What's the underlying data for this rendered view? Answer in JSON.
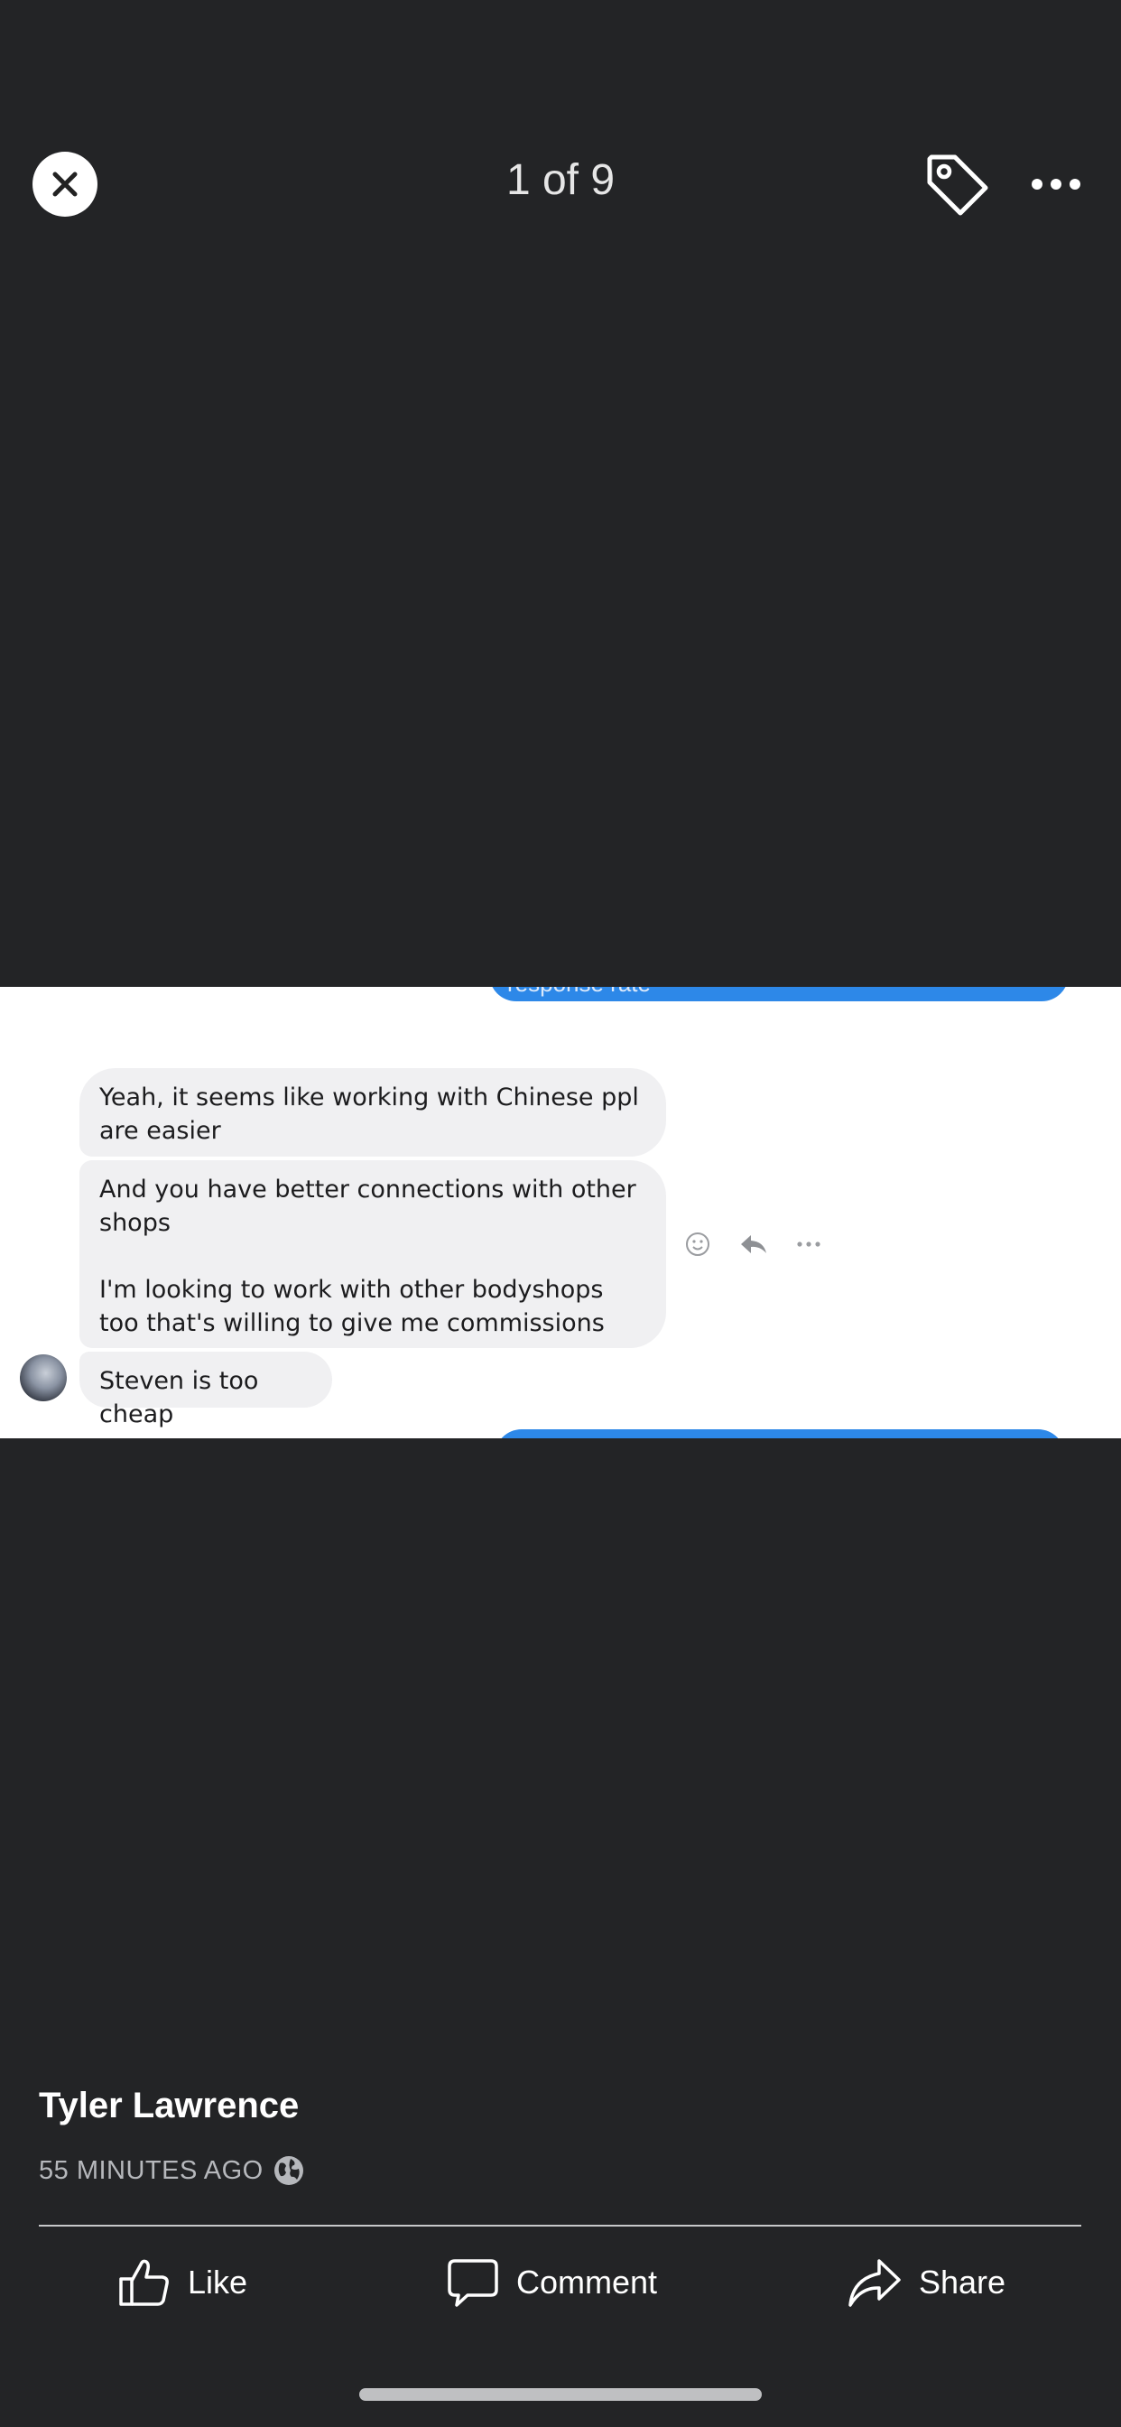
{
  "header": {
    "counter": "1 of 9",
    "close_icon": "close-icon",
    "tag_icon": "tag-icon",
    "more_icon": "more-horizontal-icon"
  },
  "photo": {
    "top_bar_text": "response rate",
    "messages": [
      "Yeah, it seems like working with Chinese ppl are easier",
      "And you have better connections with other shops\n\nI'm looking to work with other bodyshops too that's willing to give me commissions",
      "Steven is too cheap"
    ],
    "action_icons": [
      "smiley-icon",
      "reply-icon",
      "more-icon"
    ]
  },
  "post": {
    "author": "Tyler Lawrence",
    "timestamp": "55 MINUTES AGO",
    "privacy_icon": "globe-icon"
  },
  "actions": {
    "like": "Like",
    "comment": "Comment",
    "share": "Share"
  },
  "colors": {
    "background": "#232426",
    "message_blue": "#2d88e8",
    "bubble_gray": "#f0f0f2"
  }
}
